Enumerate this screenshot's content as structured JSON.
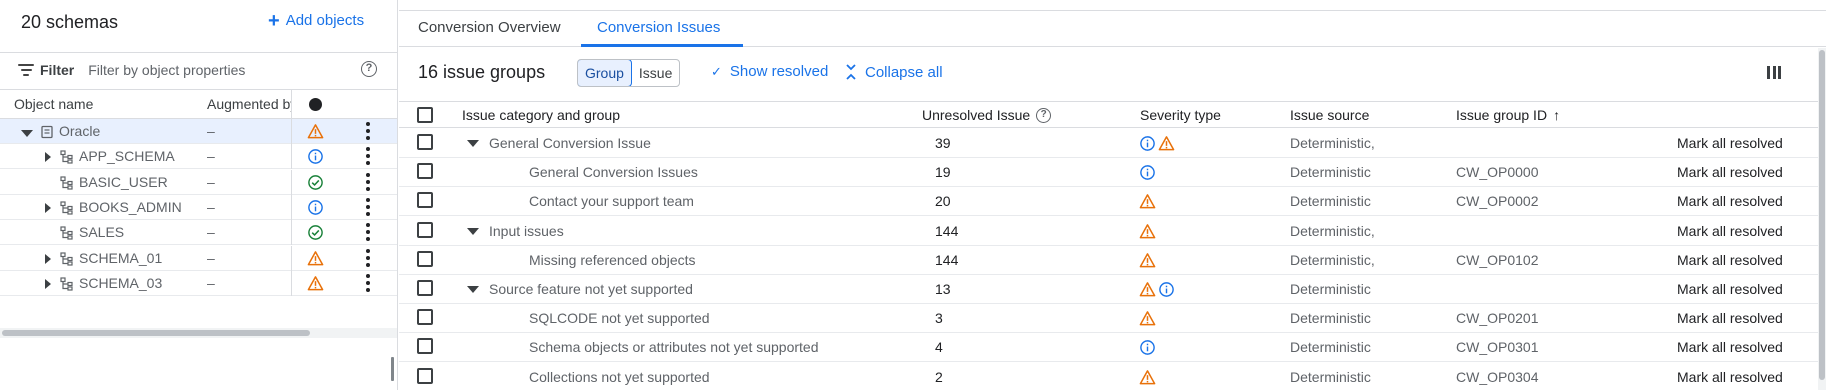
{
  "left_panel": {
    "title": "20 schemas",
    "add_objects_label": "Add objects",
    "filter_label": "Filter",
    "filter_placeholder": "Filter by object properties",
    "columns": {
      "name": "Object name",
      "augmented": "Augmented by Gemini"
    },
    "tree": [
      {
        "name": "Oracle",
        "value": "–",
        "status": "warning",
        "caret": "down",
        "icon": "database-icon",
        "selected": true
      },
      {
        "name": "APP_SCHEMA",
        "value": "–",
        "status": "info",
        "caret": "right",
        "icon": "schema-icon"
      },
      {
        "name": "BASIC_USER",
        "value": "–",
        "status": "success",
        "caret": "none",
        "icon": "schema-icon"
      },
      {
        "name": "BOOKS_ADMIN",
        "value": "–",
        "status": "info",
        "caret": "right",
        "icon": "schema-icon"
      },
      {
        "name": "SALES",
        "value": "–",
        "status": "success",
        "caret": "none",
        "icon": "schema-icon"
      },
      {
        "name": "SCHEMA_01",
        "value": "–",
        "status": "warning",
        "caret": "right",
        "icon": "schema-icon"
      },
      {
        "name": "SCHEMA_03",
        "value": "–",
        "status": "warning",
        "caret": "right",
        "icon": "schema-icon"
      }
    ]
  },
  "tabs": [
    {
      "label": "Conversion Overview",
      "active": false
    },
    {
      "label": "Conversion Issues",
      "active": true
    }
  ],
  "toolbar": {
    "count_label": "16 issue groups",
    "view_options": [
      "Group",
      "Issue"
    ],
    "view_selected": "Group",
    "show_resolved_label": "Show resolved",
    "collapse_all_label": "Collapse all"
  },
  "grid": {
    "columns": {
      "category": "Issue category and group",
      "unresolved": "Unresolved Issue",
      "severity": "Severity type",
      "source": "Issue source",
      "group_id": "Issue group ID"
    },
    "sort_column": "group_id",
    "sort_direction": "ascending",
    "rows": [
      {
        "level": 0,
        "label": "General Conversion Issue",
        "count": "39",
        "severity": [
          "info",
          "warning"
        ],
        "source": "Deterministic,",
        "id": "",
        "action": "Mark all resolved"
      },
      {
        "level": 1,
        "label": "General Conversion Issues",
        "count": "19",
        "severity": [
          "info"
        ],
        "source": "Deterministic",
        "id": "CW_OP0000",
        "action": "Mark all resolved"
      },
      {
        "level": 1,
        "label": "Contact your support team",
        "count": "20",
        "severity": [
          "warning"
        ],
        "source": "Deterministic",
        "id": "CW_OP0002",
        "action": "Mark all resolved"
      },
      {
        "level": 0,
        "label": "Input issues",
        "count": "144",
        "severity": [
          "warning"
        ],
        "source": "Deterministic,",
        "id": "",
        "action": "Mark all resolved"
      },
      {
        "level": 1,
        "label": "Missing referenced objects",
        "count": "144",
        "severity": [
          "warning"
        ],
        "source": "Deterministic,",
        "id": "CW_OP0102",
        "action": "Mark all resolved"
      },
      {
        "level": 0,
        "label": "Source feature not yet supported",
        "count": "13",
        "severity": [
          "warning",
          "info"
        ],
        "source": "Deterministic",
        "id": "",
        "action": "Mark all resolved"
      },
      {
        "level": 1,
        "label": "SQLCODE not yet supported",
        "count": "3",
        "severity": [
          "warning"
        ],
        "source": "Deterministic",
        "id": "CW_OP0201",
        "action": "Mark all resolved"
      },
      {
        "level": 1,
        "label": "Schema objects or attributes not yet supported",
        "count": "4",
        "severity": [
          "info"
        ],
        "source": "Deterministic",
        "id": "CW_OP0301",
        "action": "Mark all resolved"
      },
      {
        "level": 1,
        "label": "Collections not yet supported",
        "count": "2",
        "severity": [
          "warning"
        ],
        "source": "Deterministic",
        "id": "CW_OP0304",
        "action": "Mark all resolved"
      }
    ]
  },
  "colors": {
    "accent": "#1a73e8",
    "warning": "#e8710a",
    "info": "#1a73e8",
    "success": "#188038",
    "selected_row": "#e8f0fe"
  }
}
